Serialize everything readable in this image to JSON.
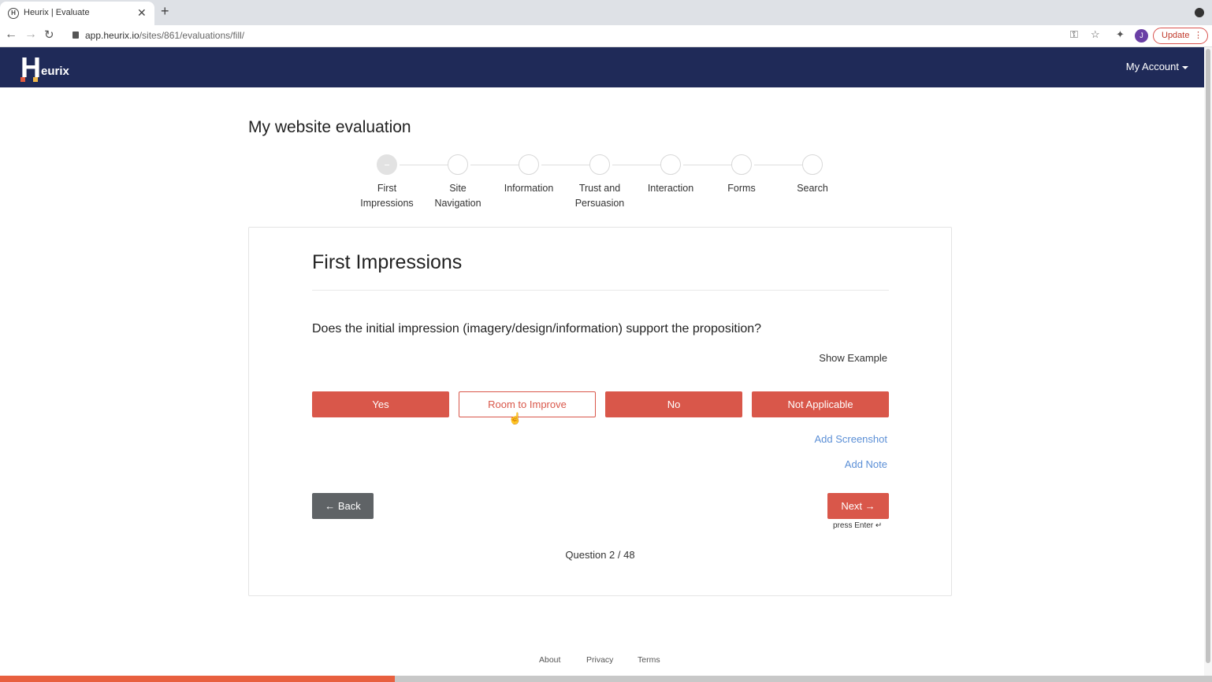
{
  "browser": {
    "tab_title": "Heurix | Evaluate",
    "favicon_letter": "H",
    "close": "✕",
    "new_tab": "+",
    "url_host": "app.heurix.io",
    "url_path": "/sites/861/evaluations/fill/",
    "avatar_initial": "J",
    "update_label": "Update",
    "menu_dots": "⋮"
  },
  "navbar": {
    "logo_letter": "H",
    "logo_rest": "eurix",
    "account_label": "My Account"
  },
  "page": {
    "title": "My website evaluation"
  },
  "steps": [
    {
      "label_line1": "First",
      "label_line2": "Impressions"
    },
    {
      "label_line1": "Site",
      "label_line2": "Navigation"
    },
    {
      "label_line1": "Information",
      "label_line2": ""
    },
    {
      "label_line1": "Trust and",
      "label_line2": "Persuasion"
    },
    {
      "label_line1": "Interaction",
      "label_line2": ""
    },
    {
      "label_line1": "Forms",
      "label_line2": ""
    },
    {
      "label_line1": "Search",
      "label_line2": ""
    }
  ],
  "card": {
    "section_title": "First Impressions",
    "question": "Does the initial impression (imagery/design/information) support the proposition?",
    "show_example": "Show Example",
    "answers": {
      "yes": "Yes",
      "room": "Room to Improve",
      "no": "No",
      "na": "Not Applicable"
    },
    "add_screenshot": "Add Screenshot",
    "add_note": "Add Note",
    "back": "Back",
    "next": "Next",
    "press_enter": "press Enter ↵",
    "counter": "Question 2 / 48"
  },
  "footer": {
    "about": "About",
    "privacy": "Privacy",
    "terms": "Terms"
  },
  "progress": {
    "fraction": 0.326
  },
  "colors": {
    "navbar": "#1f2a58",
    "accent": "#d9574a",
    "link": "#5b8fd6",
    "back_button": "#5f6366",
    "progress": "#e8603f"
  }
}
